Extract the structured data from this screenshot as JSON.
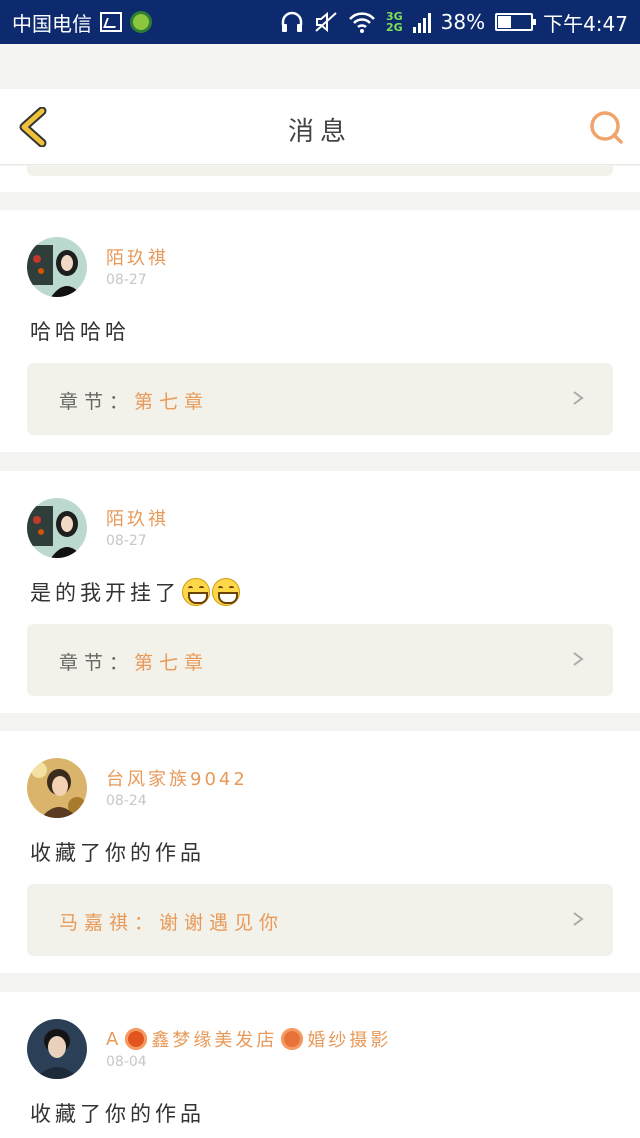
{
  "status_bar": {
    "carrier": "中国电信",
    "network_top": "3G",
    "network_bottom": "2G",
    "battery": "38%",
    "battery_level": 0.38,
    "time": "下午4:47"
  },
  "header": {
    "title": "消息"
  },
  "messages": [
    {
      "username": "陌玖祺",
      "date": "08-27",
      "text": "哈哈哈哈",
      "emoji_count": 0,
      "ref_label": "章节：",
      "ref_value": "第七章"
    },
    {
      "username": "陌玖祺",
      "date": "08-27",
      "text": "是的我开挂了",
      "emoji_count": 2,
      "ref_label": "章节：",
      "ref_value": "第七章"
    },
    {
      "username": "台风家族9042",
      "date": "08-24",
      "text": "收藏了你的作品",
      "emoji_count": 0,
      "ref_label": "马嘉祺：",
      "ref_value": "谢谢遇见你"
    },
    {
      "username_prefix": "A",
      "username_mid": "鑫梦缘美发店",
      "username_suffix": "婚纱摄影",
      "date": "08-04",
      "text": "收藏了你的作品"
    }
  ],
  "colors": {
    "status_bar_bg": "#0d2a6e",
    "accent": "#e89a5a",
    "back_icon": "#f0c23c",
    "search_icon": "#f0a46a",
    "ref_box_bg": "#f3f2ea"
  }
}
